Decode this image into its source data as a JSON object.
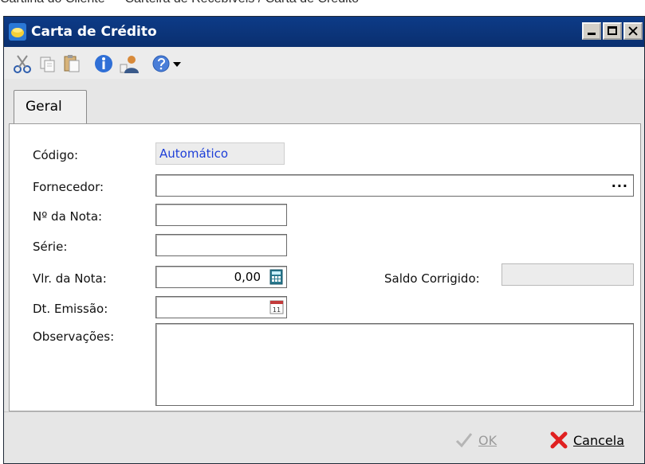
{
  "background_caption": "Cartilha do Cliente  — Carteira de Recebíveis / Carta de Crédito",
  "window": {
    "title": "Carta de Crédito"
  },
  "toolbar": {
    "icons": [
      "cut-icon",
      "copy-icon",
      "paste-icon",
      "info-icon",
      "user-icon",
      "help-icon",
      "chevron-down-icon"
    ]
  },
  "tabs": [
    {
      "label": "Geral",
      "active": true
    }
  ],
  "form": {
    "codigo": {
      "label": "Código:",
      "value": "Automático"
    },
    "fornecedor": {
      "label": "Fornecedor:",
      "value": "",
      "button": "..."
    },
    "nota": {
      "label": "Nº da Nota:",
      "value": ""
    },
    "serie": {
      "label": "Série:",
      "value": ""
    },
    "valor": {
      "label": "Vlr. da Nota:",
      "value": "0,00"
    },
    "saldo": {
      "label": "Saldo Corrigido:",
      "value": ""
    },
    "emissao": {
      "label": "Dt. Emissão:",
      "value": ""
    },
    "observacoes": {
      "label": "Observações:",
      "value": ""
    }
  },
  "footer": {
    "ok_label": "OK",
    "cancel_label": "Cancela"
  },
  "colors": {
    "title_bar": "#0d3b87",
    "auto_text": "#1e3fd8",
    "cancel_x": "#e02020"
  }
}
